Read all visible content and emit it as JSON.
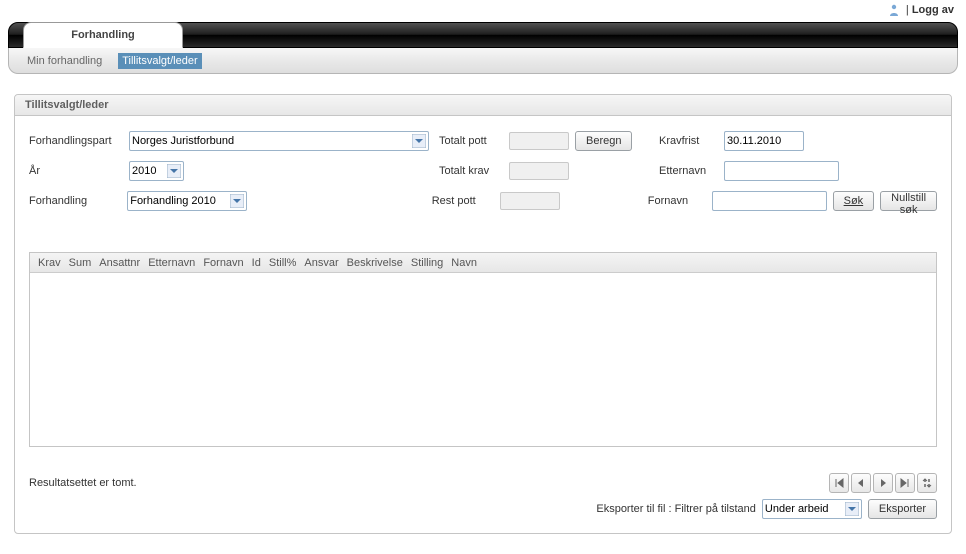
{
  "topbar": {
    "logout_label": "Logg av"
  },
  "tabs": {
    "main_tab": "Forhandling",
    "subtabs": [
      "Min forhandling",
      "Tillitsvalgt/leder"
    ],
    "active_subtab_index": 1
  },
  "panel": {
    "title": "Tillitsvalgt/leder"
  },
  "form": {
    "labels": {
      "forhandlingspart": "Forhandlingspart",
      "aar": "År",
      "forhandling": "Forhandling",
      "totalt_pott": "Totalt pott",
      "totalt_krav": "Totalt krav",
      "rest_pott": "Rest pott",
      "etternavn": "Etternavn",
      "fornavn": "Fornavn",
      "kravfrist": "Kravfrist"
    },
    "values": {
      "forhandlingspart": "Norges Juristforbund",
      "aar": "2010",
      "forhandling": "Forhandling 2010",
      "totalt_pott": "",
      "totalt_krav": "",
      "rest_pott": "",
      "etternavn": "",
      "fornavn": "",
      "kravfrist": "30.11.2010"
    },
    "buttons": {
      "beregn": "Beregn",
      "sok": "Søk",
      "nullstill": "Nullstill søk"
    }
  },
  "grid": {
    "columns": [
      "Krav",
      "Sum",
      "Ansattnr",
      "Etternavn",
      "Fornavn",
      "Id",
      "Still%",
      "Ansvar",
      "Beskrivelse",
      "Stilling",
      "Navn"
    ]
  },
  "status": {
    "message": "Resultatsettet er tomt."
  },
  "export": {
    "prefix": "Eksporter til fil : Filtrer på tilstand",
    "filter_value": "Under arbeid",
    "button": "Eksporter"
  }
}
